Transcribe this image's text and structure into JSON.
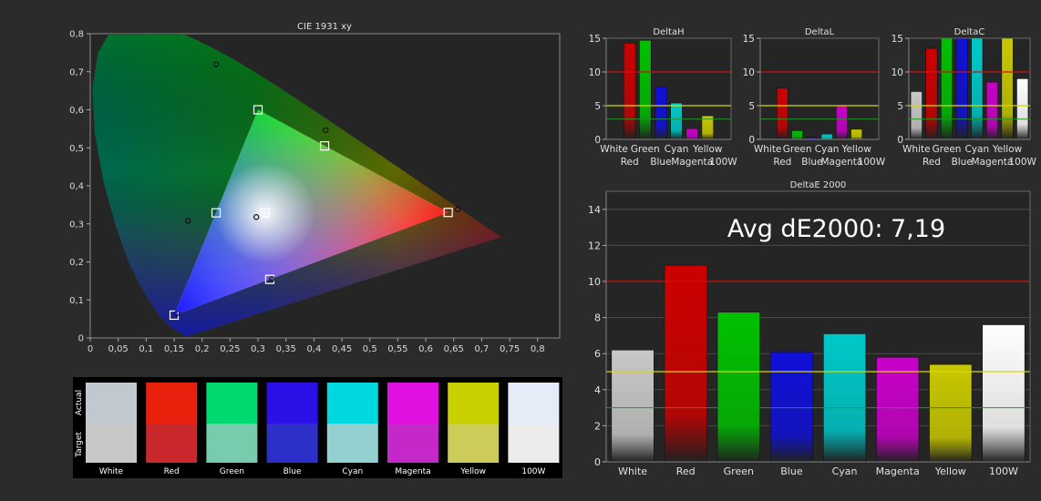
{
  "colors": {
    "background": "#2b2b2b",
    "plot_bg": "#252525",
    "red_line": "#d01010",
    "yellow_line": "#d8d800",
    "green_line": "#1e9a1e"
  },
  "cie": {
    "title": "CIE 1931 xy",
    "x_ticks": [
      "0",
      "0,05",
      "0,1",
      "0,15",
      "0,2",
      "0,25",
      "0,3",
      "0,35",
      "0,4",
      "0,45",
      "0,5",
      "0,55",
      "0,6",
      "0,65",
      "0,7",
      "0,75",
      "0,8"
    ],
    "y_ticks": [
      "0",
      "0,1",
      "0,2",
      "0,3",
      "0,4",
      "0,5",
      "0,6",
      "0,7",
      "0,8"
    ],
    "target_points": [
      {
        "name": "red",
        "x": 0.64,
        "y": 0.33
      },
      {
        "name": "green",
        "x": 0.3,
        "y": 0.6
      },
      {
        "name": "blue",
        "x": 0.15,
        "y": 0.06
      },
      {
        "name": "white",
        "x": 0.3127,
        "y": 0.329
      },
      {
        "name": "cyan",
        "x": 0.225,
        "y": 0.329
      },
      {
        "name": "magenta",
        "x": 0.321,
        "y": 0.154
      },
      {
        "name": "yellow",
        "x": 0.419,
        "y": 0.505
      }
    ],
    "measured_points": [
      {
        "name": "red",
        "x": 0.657,
        "y": 0.338
      },
      {
        "name": "green",
        "x": 0.225,
        "y": 0.72
      },
      {
        "name": "blue",
        "x": 0.155,
        "y": 0.065
      },
      {
        "name": "white",
        "x": 0.297,
        "y": 0.318
      },
      {
        "name": "cyan",
        "x": 0.175,
        "y": 0.308
      },
      {
        "name": "magenta",
        "x": 0.325,
        "y": 0.155
      },
      {
        "name": "yellow",
        "x": 0.421,
        "y": 0.546
      }
    ]
  },
  "swatches": {
    "actual_label": "Actual",
    "target_label": "Target",
    "items": [
      {
        "label": "White",
        "actual": "#c2c8d0",
        "target": "#c8c8c8"
      },
      {
        "label": "Red",
        "actual": "#e8200c",
        "target": "#c8282c"
      },
      {
        "label": "Green",
        "actual": "#00d870",
        "target": "#78ccae"
      },
      {
        "label": "Blue",
        "actual": "#2c10e8",
        "target": "#2c30c8"
      },
      {
        "label": "Cyan",
        "actual": "#00d8e0",
        "target": "#94d0d0"
      },
      {
        "label": "Magenta",
        "actual": "#e010e0",
        "target": "#c428c8"
      },
      {
        "label": "Yellow",
        "actual": "#c8d000",
        "target": "#cccc58"
      },
      {
        "label": "100W",
        "actual": "#e4ecf8",
        "target": "#ececec"
      }
    ]
  },
  "chart_data": [
    {
      "type": "bar",
      "title": "DeltaH",
      "categories": [
        "White",
        "Red",
        "Green",
        "Blue",
        "Cyan",
        "Magenta",
        "Yellow",
        "100W"
      ],
      "values": [
        0,
        14.3,
        14.7,
        7.8,
        5.4,
        1.6,
        3.5,
        0
      ],
      "ylim": [
        0,
        15
      ],
      "y_ticks": [
        "0",
        "5",
        "10",
        "15"
      ],
      "ref_lines": [
        10,
        5,
        3
      ]
    },
    {
      "type": "bar",
      "title": "DeltaL",
      "categories": [
        "White",
        "Red",
        "Green",
        "Blue",
        "Cyan",
        "Magenta",
        "Yellow",
        "100W"
      ],
      "values": [
        0,
        7.6,
        1.3,
        0.3,
        0.8,
        5.0,
        1.5,
        0
      ],
      "ylim": [
        0,
        15
      ],
      "y_ticks": [
        "0",
        "5",
        "10",
        "15"
      ],
      "ref_lines": [
        10,
        5,
        3
      ]
    },
    {
      "type": "bar",
      "title": "DeltaC",
      "categories": [
        "White",
        "Red",
        "Green",
        "Blue",
        "Cyan",
        "Magenta",
        "Yellow",
        "100W"
      ],
      "values": [
        7.1,
        13.5,
        15,
        15,
        15,
        8.5,
        15,
        9.0
      ],
      "ylim": [
        0,
        15
      ],
      "y_ticks": [
        "0",
        "5",
        "10",
        "15"
      ],
      "ref_lines": [
        10,
        5,
        3
      ]
    },
    {
      "type": "bar",
      "title": "DeltaE 2000",
      "annotation": "Avg dE2000: 7,19",
      "categories": [
        "White",
        "Red",
        "Green",
        "Blue",
        "Cyan",
        "Magenta",
        "Yellow",
        "100W"
      ],
      "values": [
        6.2,
        10.9,
        8.3,
        6.1,
        7.1,
        5.8,
        5.4,
        7.6
      ],
      "ylim": [
        0,
        15
      ],
      "y_ticks": [
        "0",
        "2",
        "4",
        "6",
        "8",
        "10",
        "12",
        "14"
      ],
      "ref_lines": [
        10,
        5,
        3
      ]
    }
  ],
  "bar_colors": {
    "White": "#c8c8c8",
    "Red": "#cc0000",
    "Green": "#00c000",
    "Blue": "#1010d8",
    "Cyan": "#00c8c8",
    "Magenta": "#c800c8",
    "Yellow": "#c8c800",
    "100W": "#ffffff"
  }
}
